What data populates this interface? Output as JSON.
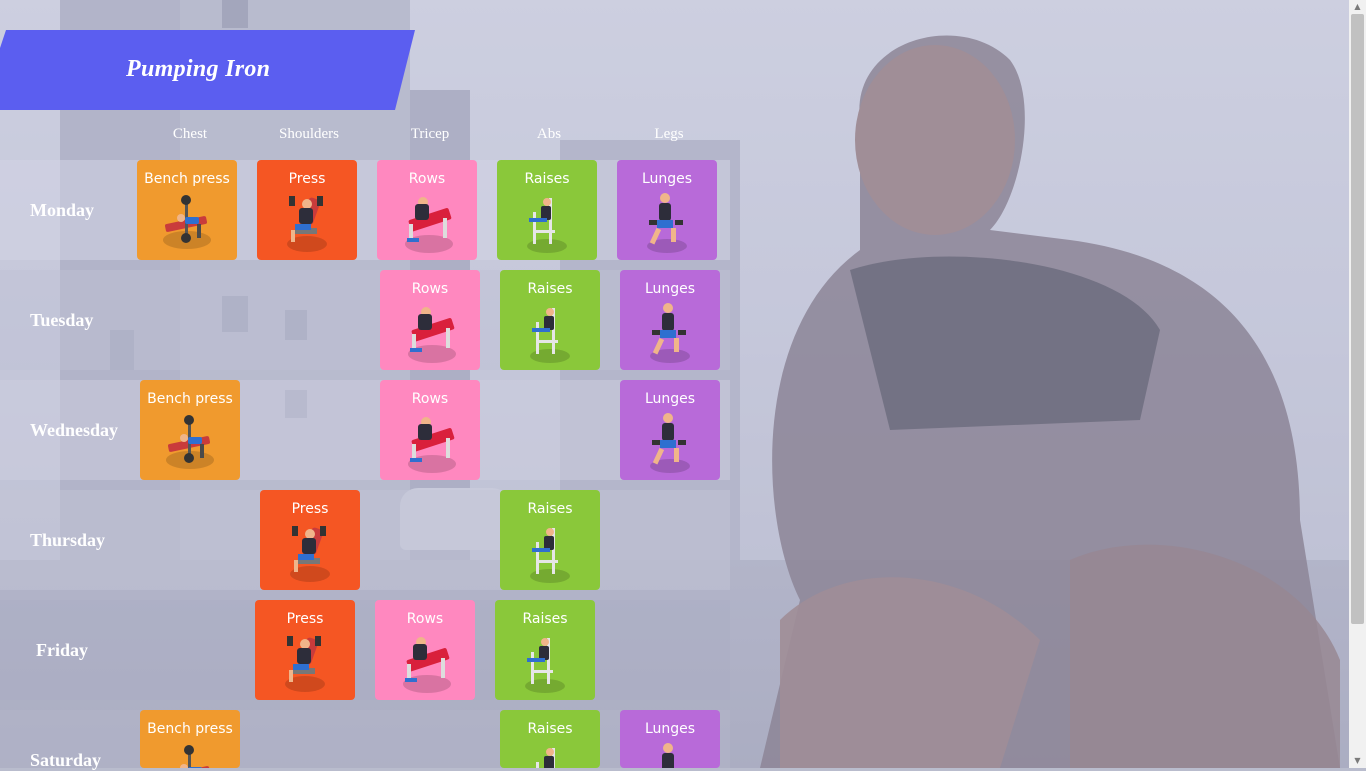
{
  "app": {
    "title": "Pumping Iron"
  },
  "columns": [
    "Chest",
    "Shoulders",
    "Tricep",
    "Abs",
    "Legs"
  ],
  "days": [
    {
      "name": "Monday",
      "exercises": [
        "Bench press",
        "Press",
        "Rows",
        "Raises",
        "Lunges"
      ]
    },
    {
      "name": "Tuesday",
      "exercises": [
        "Rows",
        "Raises",
        "Lunges"
      ]
    },
    {
      "name": "Wednesday",
      "exercises": [
        "Bench press",
        "Rows",
        "Lunges"
      ]
    },
    {
      "name": "Thursday",
      "exercises": [
        "Press",
        "Raises"
      ]
    },
    {
      "name": "Friday",
      "exercises": [
        "Press",
        "Rows",
        "Raises"
      ]
    },
    {
      "name": "Saturday",
      "exercises": [
        "Bench press",
        "Raises",
        "Lunges"
      ]
    }
  ],
  "colors": {
    "banner": "#5b5ef0",
    "chest": "#f09a2e",
    "shoulders": "#f55623",
    "tricep": "#ff88bf",
    "abs": "#8ac83a",
    "legs": "#b86ad9"
  },
  "icons": {
    "bench_press": "bench-press-athlete-icon",
    "press": "shoulder-press-athlete-icon",
    "rows": "dumbbell-row-athlete-icon",
    "raises": "leg-raise-station-icon",
    "lunges": "dumbbell-lunge-athlete-icon"
  }
}
